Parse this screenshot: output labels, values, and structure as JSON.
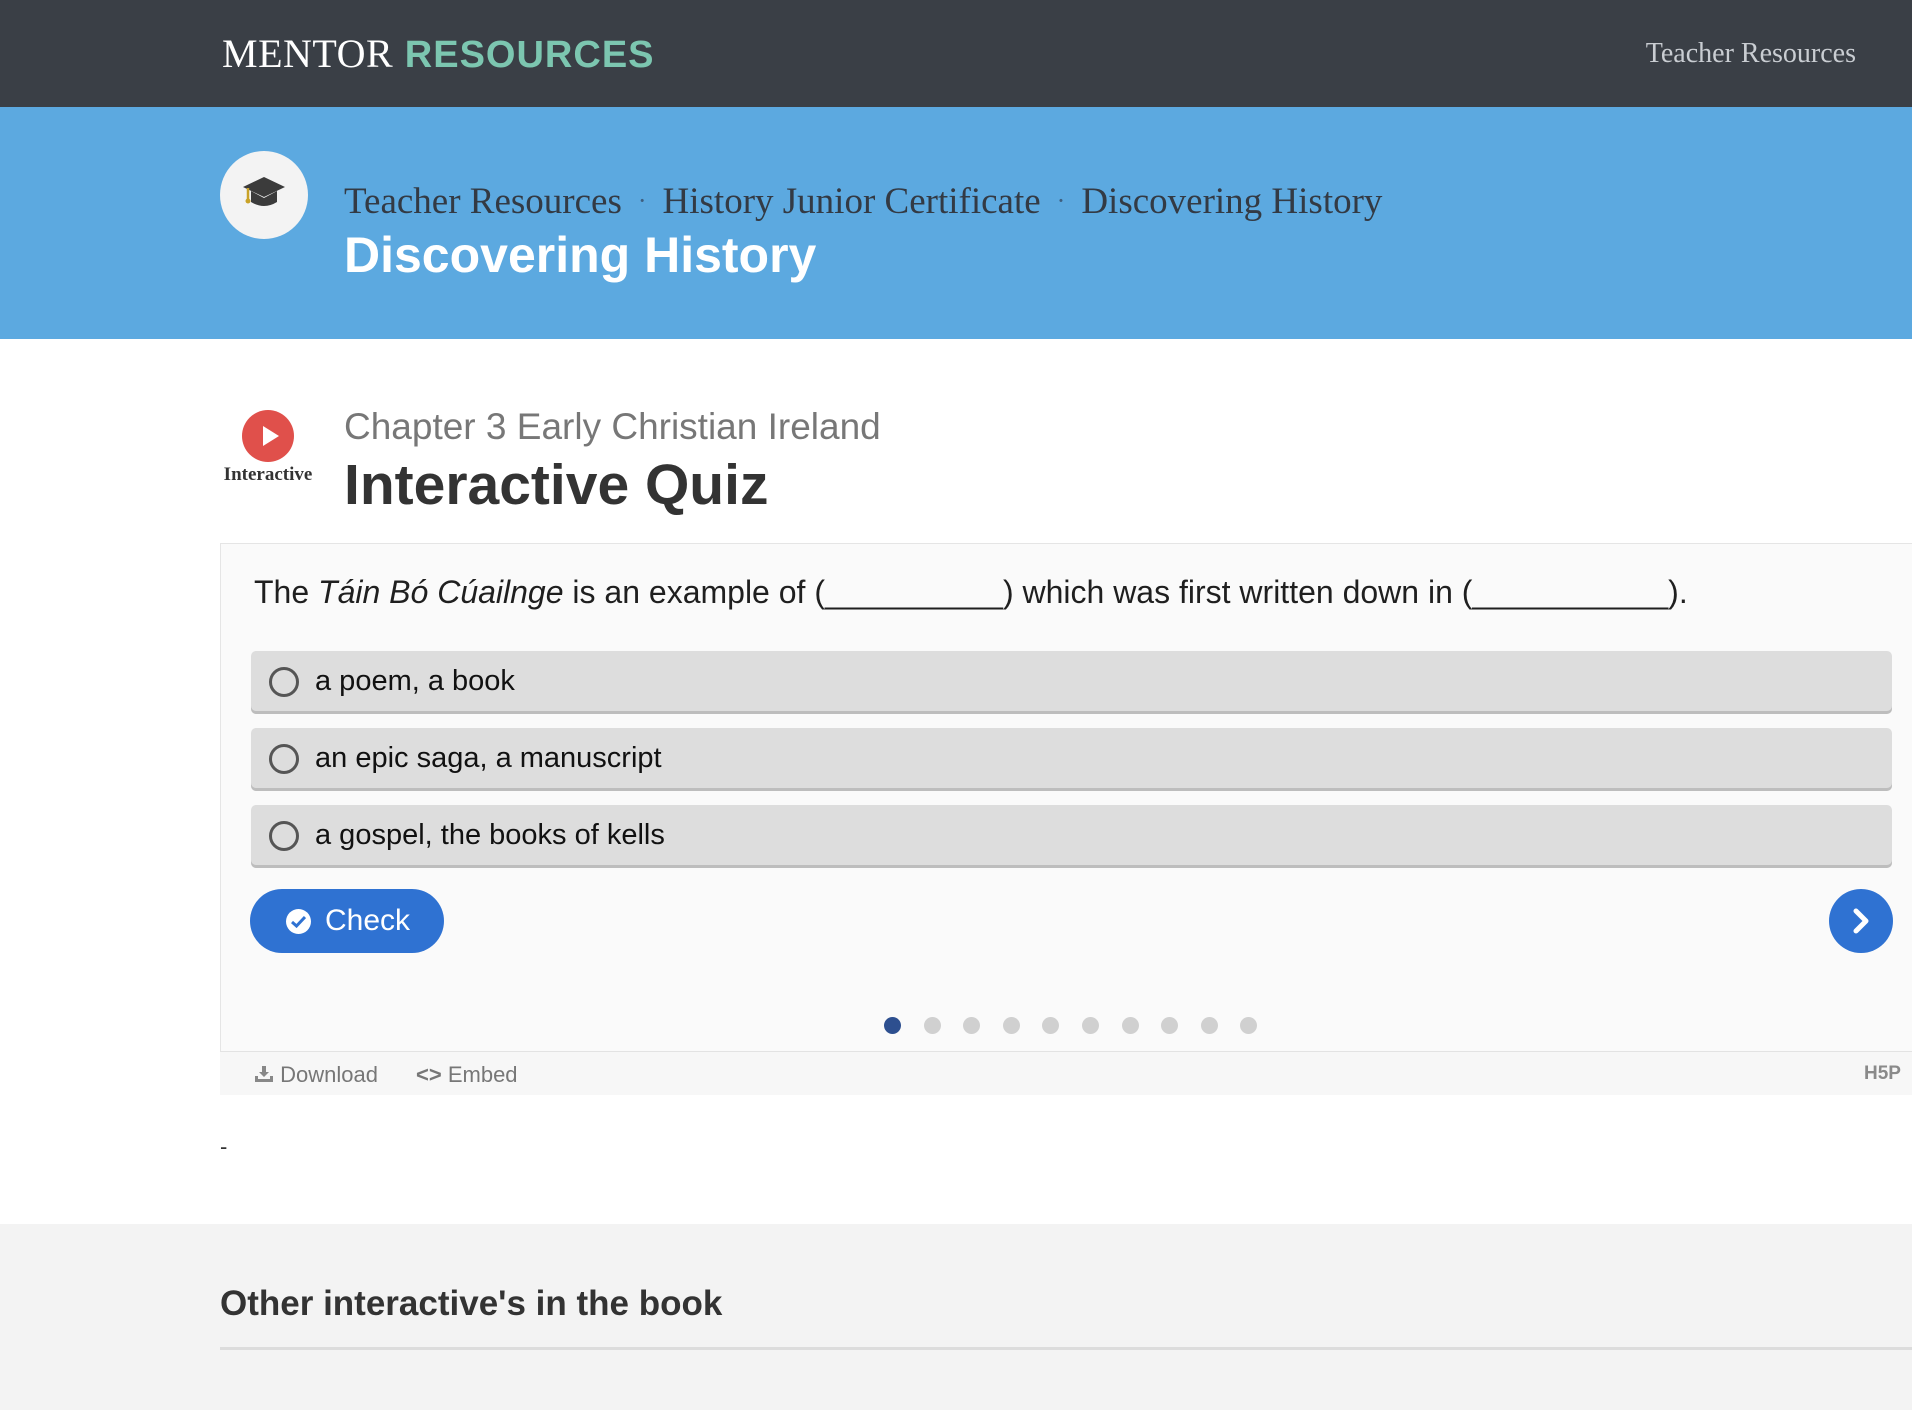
{
  "topbar": {
    "logo_part1": "MENTOR",
    "logo_part2": "RESOURCES",
    "nav_link": "Teacher Resources"
  },
  "hero": {
    "icon": "graduation-cap-icon",
    "breadcrumbs": [
      "Teacher Resources",
      "History Junior Certificate",
      "Discovering History"
    ],
    "separator": "·",
    "title": "Discovering History"
  },
  "resource": {
    "type_icon": "play-icon",
    "type_label": "Interactive",
    "chapter": "Chapter 3 Early Christian Ireland",
    "title": "Interactive Quiz"
  },
  "quiz": {
    "question_pre": "The ",
    "question_italic": "Táin Bó Cúailnge",
    "question_post": " is an example of (__________) which was first written down in (___________).",
    "options": [
      "a poem, a book",
      "an epic saga, a manuscript",
      "a gospel, the books of kells"
    ],
    "check_label": "Check",
    "total_questions": 10,
    "current_question": 1,
    "footer": {
      "download_label": "Download",
      "embed_label": "Embed",
      "brand": "H5P"
    }
  },
  "after_quiz_text": "-",
  "other_section": {
    "title": "Other interactive's in the book"
  },
  "colors": {
    "topbar": "#3a3f46",
    "logo_accent": "#7cc6b0",
    "hero": "#5ca9e0",
    "play": "#e0504b",
    "button": "#2f72d2",
    "active_dot": "#2d4f8f"
  }
}
